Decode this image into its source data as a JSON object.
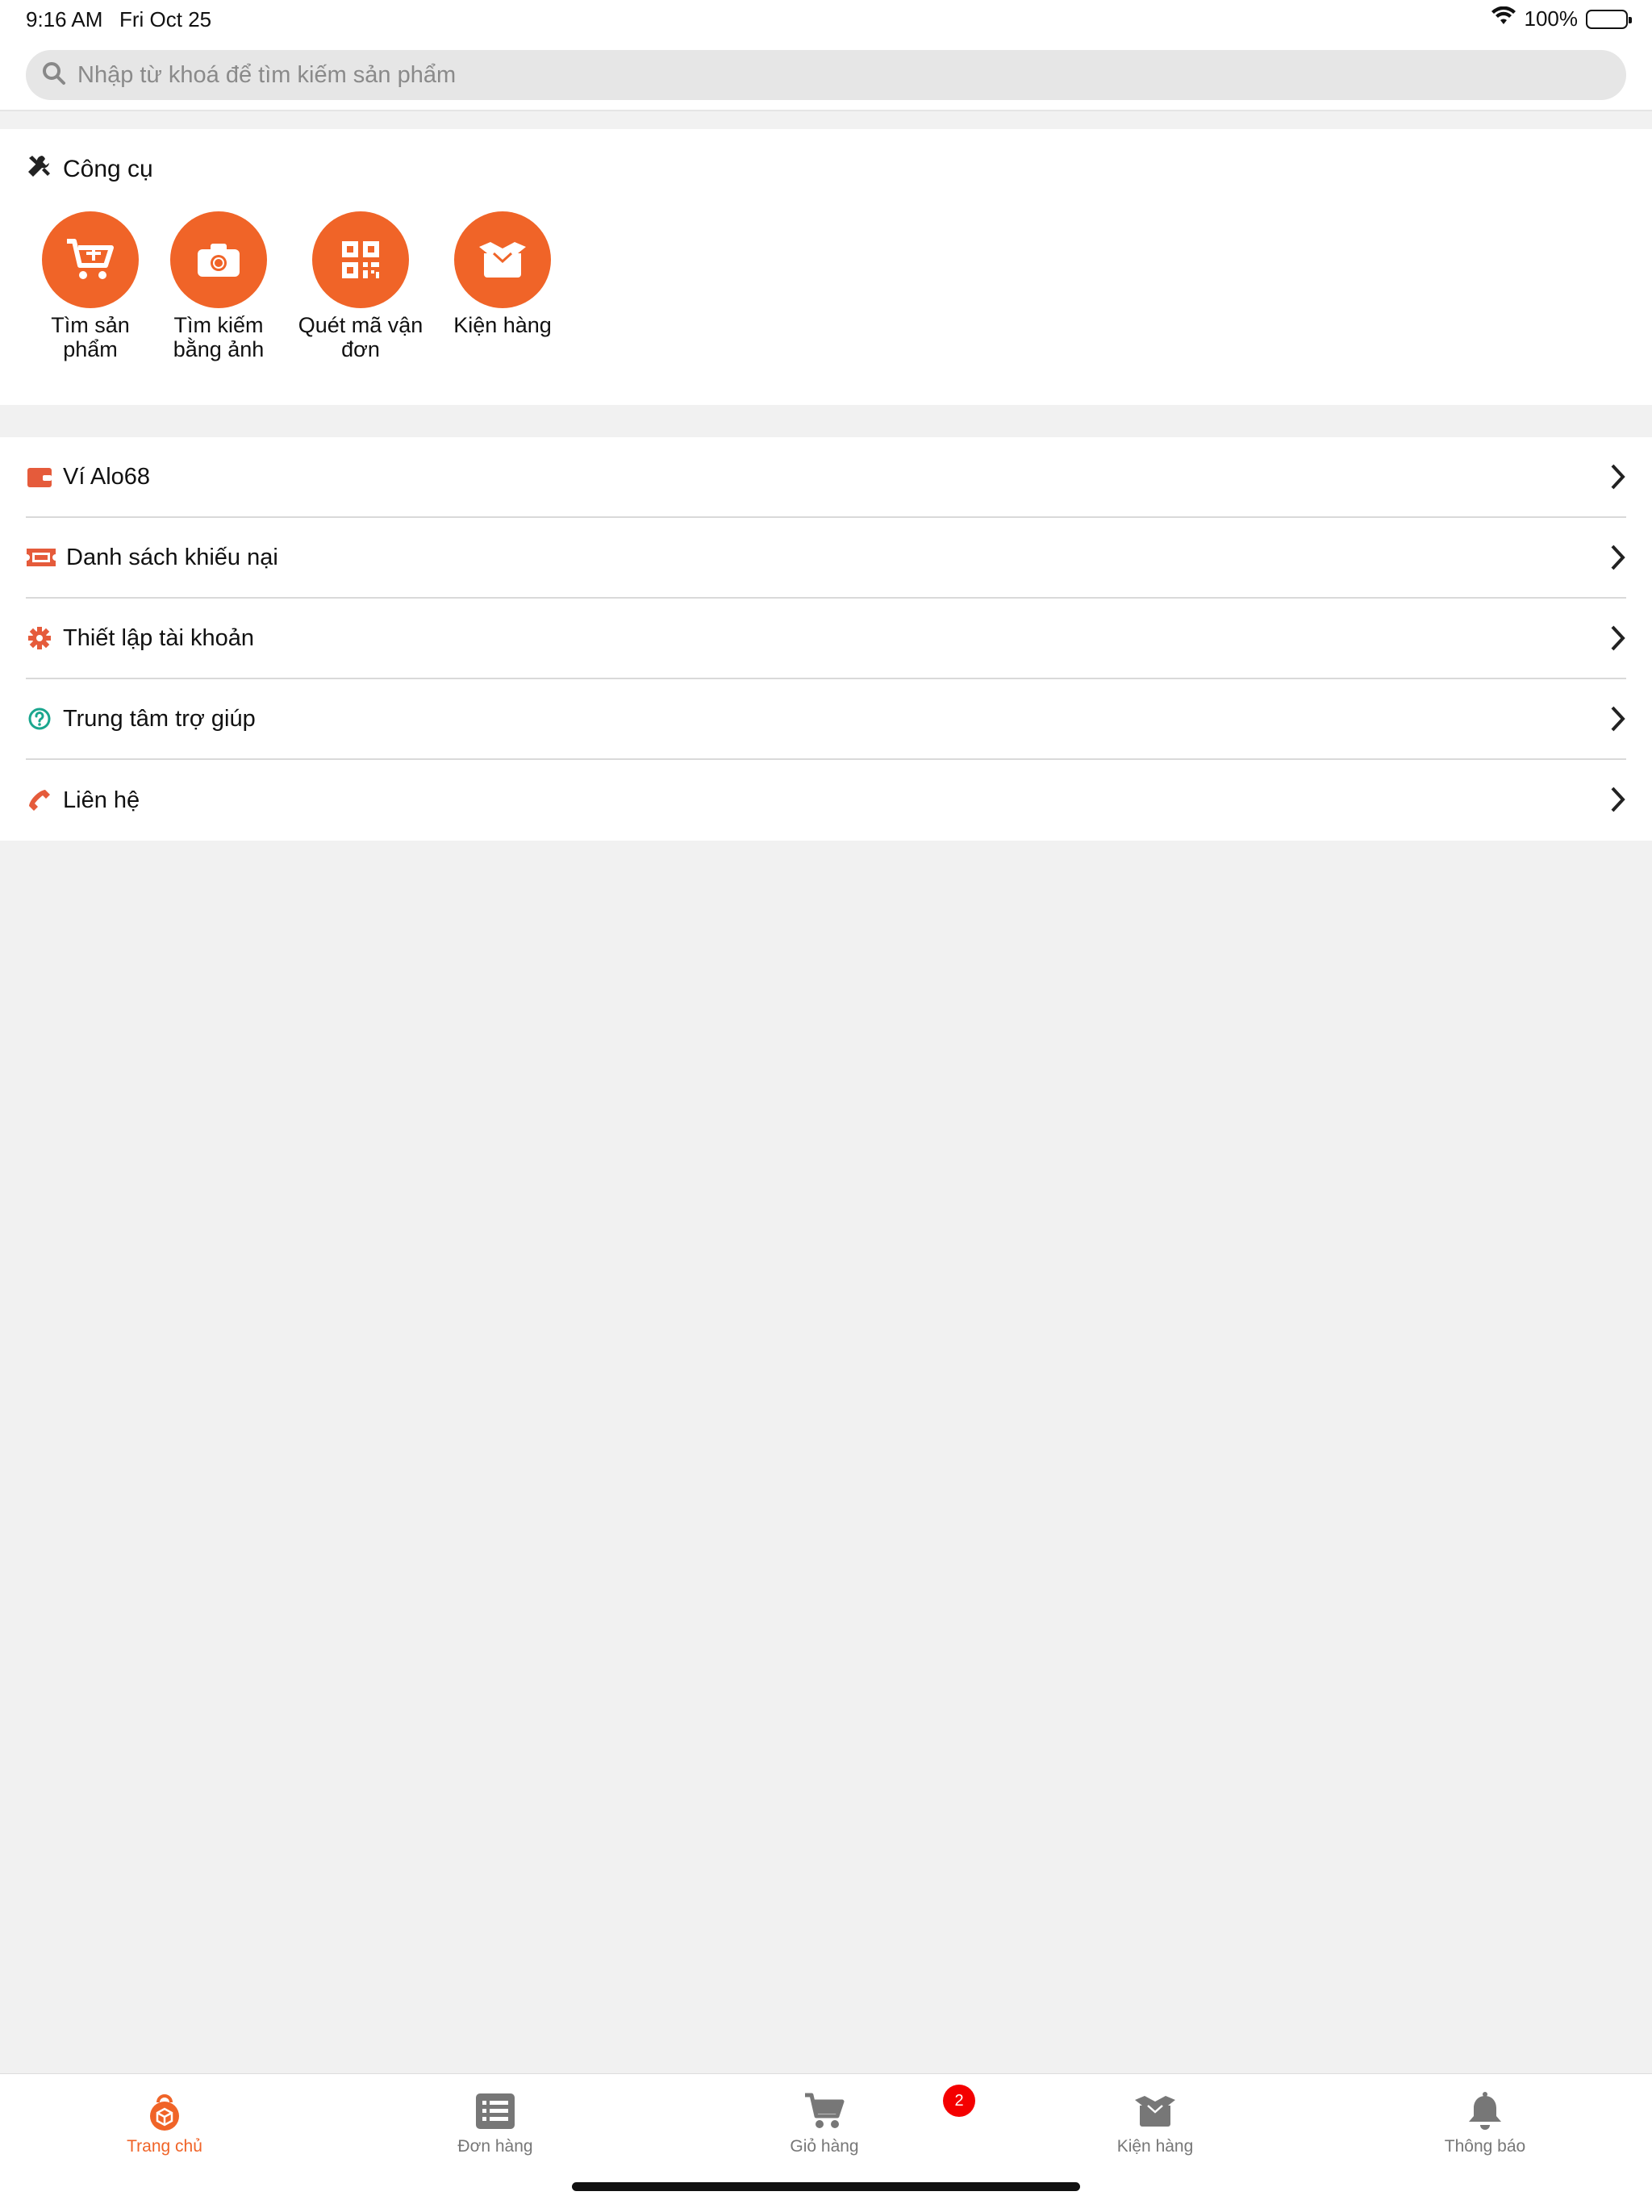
{
  "status_bar": {
    "time": "9:16 AM",
    "date": "Fri Oct 25",
    "battery": "100%"
  },
  "search": {
    "placeholder": "Nhập từ khoá để tìm kiếm sản phẩm"
  },
  "tools": {
    "title": "Công cụ",
    "items": [
      {
        "label": "Tìm sản phẩm",
        "icon": "cart-plus-icon"
      },
      {
        "label": "Tìm kiếm bằng ảnh",
        "icon": "camera-icon"
      },
      {
        "label": "Quét mã vận đơn",
        "icon": "qr-code-icon"
      },
      {
        "label": "Kiện hàng",
        "icon": "box-icon"
      }
    ]
  },
  "menu": {
    "items": [
      {
        "label": "Ví Alo68",
        "icon": "wallet-icon"
      },
      {
        "label": "Danh sách khiếu nại",
        "icon": "ticket-icon"
      },
      {
        "label": "Thiết lập tài khoản",
        "icon": "gear-icon"
      },
      {
        "label": "Trung tâm trợ giúp",
        "icon": "question-circle-icon"
      },
      {
        "label": "Liên hệ",
        "icon": "phone-icon"
      }
    ]
  },
  "tab_bar": {
    "tabs": [
      {
        "label": "Trang chủ",
        "icon": "home-bag-icon",
        "active": true
      },
      {
        "label": "Đơn hàng",
        "icon": "list-icon"
      },
      {
        "label": "Giỏ hàng",
        "icon": "cart-icon"
      },
      {
        "label": "Kiện hàng",
        "icon": "box-icon"
      },
      {
        "label": "Thông báo",
        "icon": "bell-icon"
      }
    ],
    "cart_badge": "2"
  },
  "colors": {
    "accent": "#f06428",
    "badge": "#f40000",
    "help_icon": "#1aa68e"
  }
}
